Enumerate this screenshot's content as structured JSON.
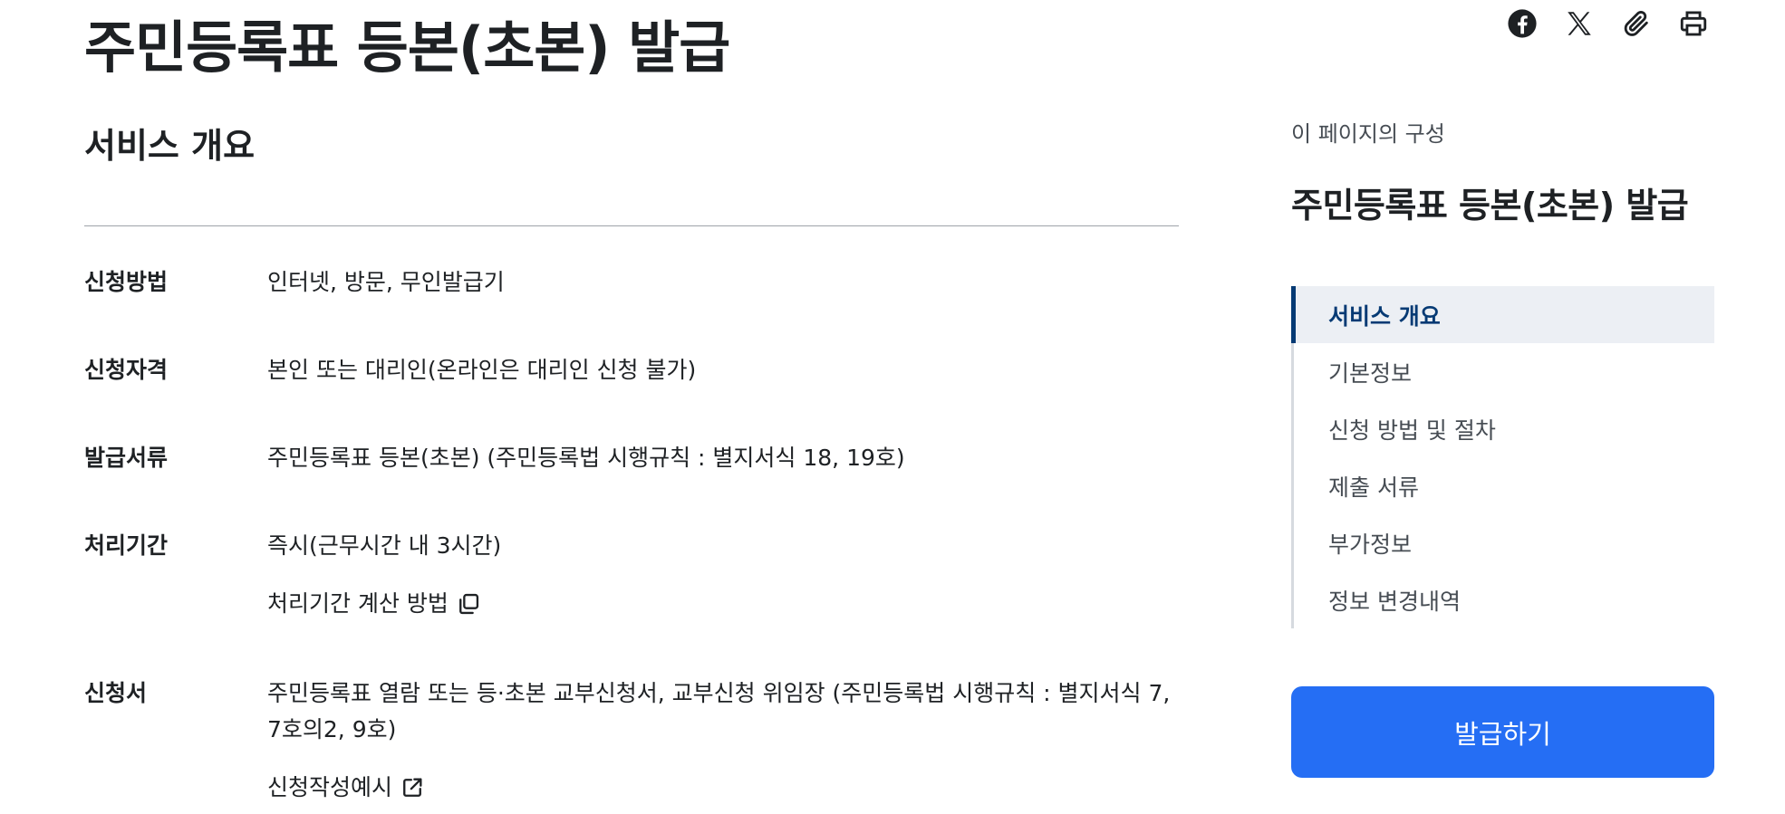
{
  "page": {
    "title": "주민등록표 등본(초본) 발급"
  },
  "share": [
    {
      "icon": "facebook-icon",
      "name": "facebook"
    },
    {
      "icon": "x-icon",
      "name": "x"
    },
    {
      "icon": "paperclip-icon",
      "name": "copy-link"
    },
    {
      "icon": "print-icon",
      "name": "print"
    }
  ],
  "overview": {
    "title": "서비스 개요",
    "rows": {
      "method": {
        "label": "신청방법",
        "value": "인터넷, 방문, 무인발급기"
      },
      "qualification": {
        "label": "신청자격",
        "value": "본인 또는 대리인(온라인은 대리인 신청 불가)"
      },
      "documents": {
        "label": "발급서류",
        "value": "주민등록표 등본(초본) (주민등록법 시행규칙 : 별지서식 18, 19호)"
      },
      "period": {
        "label": "처리기간",
        "value": "즉시(근무시간 내 3시간)",
        "link": "처리기간 계산 방법",
        "link_icon": "copy-icon"
      },
      "form": {
        "label": "신청서",
        "value": "주민등록표 열람 또는 등·초본 교부신청서, 교부신청 위임장 (주민등록법 시행규칙 : 별지서식 7, 7호의2, 9호)",
        "link": "신청작성예시",
        "link_icon": "external-link-icon"
      }
    }
  },
  "toc": {
    "caption": "이 페이지의 구성",
    "title": "주민등록표 등본(초본) 발급",
    "items": [
      {
        "label": "서비스 개요",
        "active": true
      },
      {
        "label": "기본정보"
      },
      {
        "label": "신청 방법 및 절차"
      },
      {
        "label": "제출 서류"
      },
      {
        "label": "부가정보"
      },
      {
        "label": "정보 변경내역"
      }
    ]
  },
  "action": {
    "issue_label": "발급하기"
  },
  "colors": {
    "primary": "#256ef4",
    "toc_active": "#063a74",
    "toc_active_bg": "#eceff4",
    "text": "#1e2124"
  }
}
